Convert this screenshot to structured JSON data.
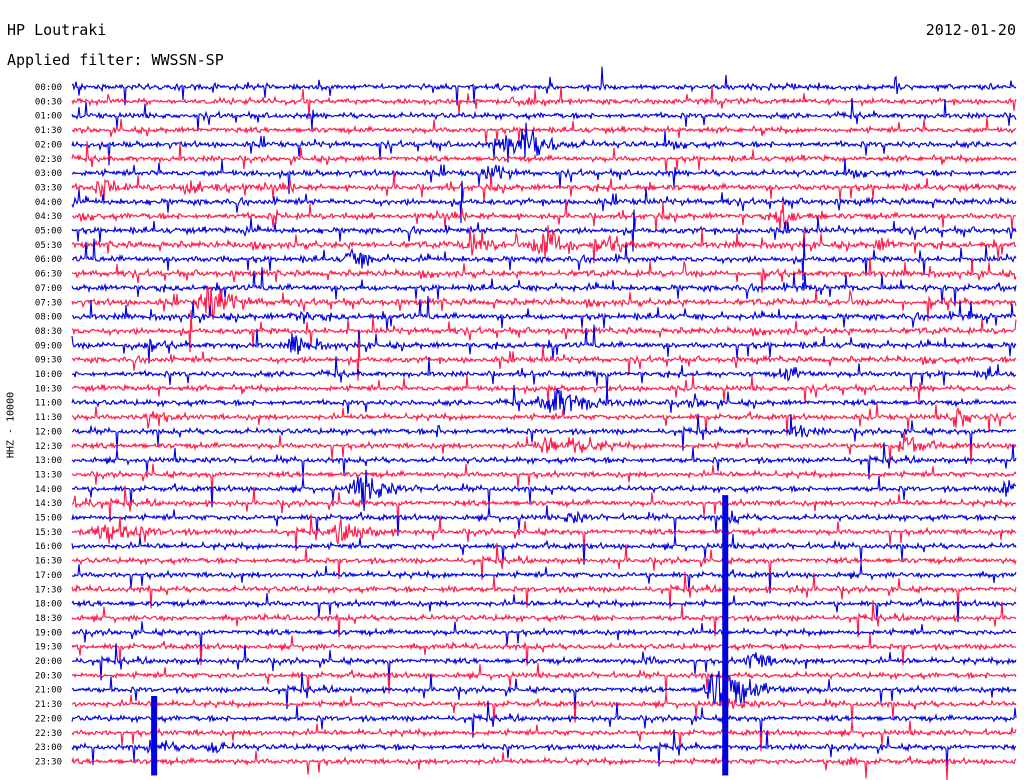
{
  "header": {
    "station": "HP Loutraki",
    "date": "2012-01-20",
    "filter": "Applied filter: WWSSN-SP"
  },
  "chart_data": {
    "type": "line",
    "title": "HP Loutraki",
    "ylabel": "HHZ - 10000",
    "colors": [
      "#0000e0",
      "#ff1a48"
    ],
    "rows": [
      {
        "label": "00:00",
        "noise": 3.0,
        "spikes": 0.55,
        "events": []
      },
      {
        "label": "00:30",
        "noise": 3.0,
        "spikes": 0.5,
        "events": [
          [
            0.47,
            4,
            0.02
          ]
        ]
      },
      {
        "label": "01:00",
        "noise": 3.0,
        "spikes": 0.5,
        "events": []
      },
      {
        "label": "01:30",
        "noise": 3.0,
        "spikes": 0.5,
        "events": []
      },
      {
        "label": "02:00",
        "noise": 3.2,
        "spikes": 0.55,
        "events": [
          [
            0.475,
            22,
            0.025
          ]
        ]
      },
      {
        "label": "02:30",
        "noise": 3.0,
        "spikes": 0.55,
        "events": []
      },
      {
        "label": "03:00",
        "noise": 3.2,
        "spikes": 0.55,
        "events": [
          [
            0.445,
            12,
            0.012
          ]
        ]
      },
      {
        "label": "03:30",
        "noise": 3.4,
        "spikes": 0.7,
        "events": [
          [
            0.035,
            7,
            0.015
          ],
          [
            0.125,
            6,
            0.012
          ],
          [
            0.16,
            6,
            0.012
          ]
        ]
      },
      {
        "label": "04:00",
        "noise": 3.4,
        "spikes": 0.75,
        "events": []
      },
      {
        "label": "04:30",
        "noise": 3.3,
        "spikes": 0.7,
        "events": [
          [
            0.755,
            12,
            0.015
          ]
        ]
      },
      {
        "label": "05:00",
        "noise": 3.3,
        "spikes": 0.75,
        "events": []
      },
      {
        "label": "05:30",
        "noise": 3.6,
        "spikes": 0.9,
        "events": [
          [
            0.425,
            13,
            0.015
          ],
          [
            0.505,
            20,
            0.02
          ],
          [
            0.575,
            5,
            0.02
          ],
          [
            0.86,
            5,
            0.015
          ]
        ]
      },
      {
        "label": "06:00",
        "noise": 3.4,
        "spikes": 0.85,
        "events": [
          [
            0.3,
            10,
            0.015
          ]
        ]
      },
      {
        "label": "06:30",
        "noise": 3.4,
        "spikes": 0.9,
        "events": []
      },
      {
        "label": "07:00",
        "noise": 3.4,
        "spikes": 0.9,
        "events": []
      },
      {
        "label": "07:30",
        "noise": 3.6,
        "spikes": 0.95,
        "events": [
          [
            0.15,
            20,
            0.02
          ]
        ]
      },
      {
        "label": "08:00",
        "noise": 3.4,
        "spikes": 0.9,
        "events": [
          [
            0.24,
            5,
            0.015
          ]
        ]
      },
      {
        "label": "08:30",
        "noise": 3.4,
        "spikes": 0.85,
        "events": []
      },
      {
        "label": "09:00",
        "noise": 3.3,
        "spikes": 0.8,
        "events": [
          [
            0.07,
            6,
            0.012
          ],
          [
            0.24,
            10,
            0.015
          ]
        ]
      },
      {
        "label": "09:30",
        "noise": 3.2,
        "spikes": 0.7,
        "events": []
      },
      {
        "label": "10:00",
        "noise": 3.0,
        "spikes": 0.6,
        "events": [
          [
            0.76,
            6,
            0.015
          ],
          [
            0.97,
            5,
            0.01
          ]
        ]
      },
      {
        "label": "10:30",
        "noise": 3.0,
        "spikes": 0.5,
        "events": []
      },
      {
        "label": "11:00",
        "noise": 3.0,
        "spikes": 0.5,
        "events": [
          [
            0.515,
            15,
            0.03
          ],
          [
            0.66,
            5,
            0.01
          ]
        ]
      },
      {
        "label": "11:30",
        "noise": 3.0,
        "spikes": 0.45,
        "events": [
          [
            0.085,
            8,
            0.012
          ],
          [
            0.94,
            11,
            0.015
          ]
        ]
      },
      {
        "label": "12:00",
        "noise": 3.0,
        "spikes": 0.45,
        "events": [
          [
            0.39,
            4,
            0.01
          ],
          [
            0.77,
            6,
            0.015
          ]
        ]
      },
      {
        "label": "12:30",
        "noise": 3.0,
        "spikes": 0.45,
        "events": [
          [
            0.505,
            7,
            0.02
          ],
          [
            0.54,
            7,
            0.02
          ],
          [
            0.885,
            12,
            0.015
          ]
        ]
      },
      {
        "label": "13:00",
        "noise": 3.0,
        "spikes": 0.4,
        "events": []
      },
      {
        "label": "13:30",
        "noise": 3.0,
        "spikes": 0.4,
        "events": []
      },
      {
        "label": "14:00",
        "noise": 3.0,
        "spikes": 0.4,
        "events": [
          [
            0.31,
            17,
            0.02
          ],
          [
            0.99,
            10,
            0.01
          ]
        ]
      },
      {
        "label": "14:30",
        "noise": 3.0,
        "spikes": 0.4,
        "events": [
          [
            0.005,
            9,
            0.015
          ]
        ]
      },
      {
        "label": "15:00",
        "noise": 3.0,
        "spikes": 0.4,
        "events": [
          [
            0.53,
            5,
            0.012
          ],
          [
            0.7,
            4,
            0.01
          ]
        ]
      },
      {
        "label": "15:30",
        "noise": 3.0,
        "spikes": 0.4,
        "events": [
          [
            0.04,
            9,
            0.035
          ],
          [
            0.29,
            9,
            0.025
          ]
        ]
      },
      {
        "label": "16:00",
        "noise": 3.0,
        "spikes": 0.4,
        "events": []
      },
      {
        "label": "16:30",
        "noise": 3.0,
        "spikes": 0.35,
        "events": []
      },
      {
        "label": "17:00",
        "noise": 3.0,
        "spikes": 0.35,
        "events": []
      },
      {
        "label": "17:30",
        "noise": 3.0,
        "spikes": 0.35,
        "events": [
          [
            0.4,
            3,
            0.01
          ],
          [
            0.77,
            3,
            0.01
          ]
        ]
      },
      {
        "label": "18:00",
        "noise": 3.0,
        "spikes": 0.35,
        "events": []
      },
      {
        "label": "18:30",
        "noise": 3.0,
        "spikes": 0.35,
        "events": []
      },
      {
        "label": "19:00",
        "noise": 3.0,
        "spikes": 0.35,
        "events": []
      },
      {
        "label": "19:30",
        "noise": 3.0,
        "spikes": 0.35,
        "events": []
      },
      {
        "label": "20:00",
        "noise": 3.0,
        "spikes": 0.35,
        "events": [
          [
            0.61,
            4,
            0.01
          ],
          [
            0.725,
            10,
            0.015
          ]
        ]
      },
      {
        "label": "20:30",
        "noise": 3.0,
        "spikes": 0.4,
        "events": []
      },
      {
        "label": "21:00",
        "noise": 3.0,
        "spikes": 0.4,
        "events": [
          [
            0.69,
            22,
            0.03
          ]
        ]
      },
      {
        "label": "21:30",
        "noise": 3.0,
        "spikes": 0.4,
        "events": [
          [
            0.7,
            4,
            0.015
          ]
        ]
      },
      {
        "label": "22:00",
        "noise": 3.0,
        "spikes": 0.4,
        "events": []
      },
      {
        "label": "22:30",
        "noise": 3.0,
        "spikes": 0.4,
        "events": []
      },
      {
        "label": "23:00",
        "noise": 3.0,
        "spikes": 0.45,
        "events": [
          [
            0.09,
            8,
            0.015
          ],
          [
            0.15,
            5,
            0.015
          ]
        ]
      },
      {
        "label": "23:30",
        "noise": 3.0,
        "spikes": 0.45,
        "events": [
          [
            0.82,
            6,
            0.008
          ]
        ]
      }
    ],
    "big_events": [
      {
        "x": 0.692,
        "row_from": 29,
        "row_to": 47
      },
      {
        "x": 0.087,
        "row_from": 43,
        "row_to": 47
      }
    ]
  }
}
